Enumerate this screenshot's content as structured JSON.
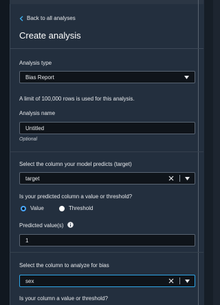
{
  "nav": {
    "back_label": "Back to all analyses"
  },
  "page": {
    "title": "Create analysis"
  },
  "analysis_type": {
    "label": "Analysis type",
    "value": "Bias Report"
  },
  "row_limit_note": "A limit of 100,000 rows is used for this analysis.",
  "analysis_name": {
    "label": "Analysis name",
    "value": "Untitled",
    "hint": "Optional"
  },
  "target_column": {
    "label": "Select the column your model predicts (target)",
    "value": "target"
  },
  "predicted_type": {
    "question": "Is your predicted column a value or threshold?",
    "options": [
      {
        "label": "Value",
        "selected": true
      },
      {
        "label": "Threshold",
        "selected": false
      }
    ]
  },
  "predicted_values": {
    "label": "Predicted value(s)",
    "value": "1"
  },
  "bias_column": {
    "label": "Select the column to analyze for bias",
    "value": "sex"
  },
  "bias_column_type": {
    "question": "Is your column a value or threshold?"
  },
  "colors": {
    "panel": "#232f3e",
    "accent": "#2ea6e8",
    "input_bg": "#0f141a"
  }
}
